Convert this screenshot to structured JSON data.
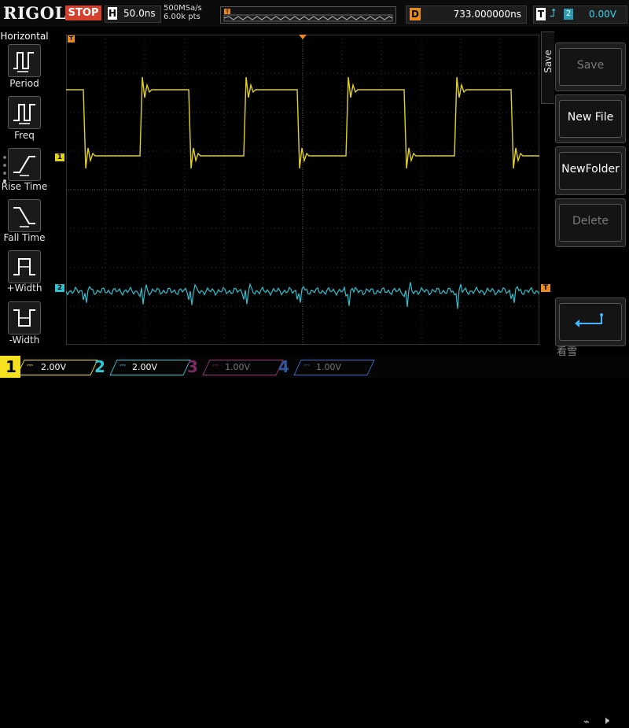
{
  "brand": "RIGOL",
  "run_state": "STOP",
  "timebase": {
    "letter": "H",
    "scale": "50.0ns"
  },
  "acquisition": {
    "sample_rate": "500MSa/s",
    "points": "6.00k pts"
  },
  "delay": {
    "letter": "D",
    "value": "733.000000ns"
  },
  "trigger": {
    "letter": "T",
    "edge_icon": "rising-edge-icon",
    "source": "2",
    "level": "0.00V"
  },
  "left_menu": {
    "title": "Horizontal",
    "items": [
      {
        "label": "Period",
        "icon": "period-icon"
      },
      {
        "label": "Freq",
        "icon": "freq-icon"
      },
      {
        "label": "Rise Time",
        "icon": "rise-time-icon"
      },
      {
        "label": "Fall Time",
        "icon": "fall-time-icon"
      },
      {
        "label": "+Width",
        "icon": "pos-width-icon"
      },
      {
        "label": "-Width",
        "icon": "neg-width-icon"
      }
    ]
  },
  "right_menu": {
    "tab": "Save",
    "items": [
      {
        "label": "Save",
        "enabled": false
      },
      {
        "label": "New File",
        "enabled": true
      },
      {
        "label": "NewFolder",
        "enabled": true
      },
      {
        "label": "Delete",
        "enabled": false
      },
      {
        "label": "",
        "icon": "enter-icon",
        "enabled": true
      }
    ]
  },
  "markers": {
    "ch1": "1",
    "ch2": "2",
    "trigger": "T"
  },
  "channels": [
    {
      "num": "1",
      "scale": "2.00V",
      "color": "#f5e11f",
      "active": true
    },
    {
      "num": "2",
      "scale": "2.00V",
      "color": "#2ec9d6",
      "active": true
    },
    {
      "num": "3",
      "scale": "1.00V",
      "color": "#a0307a",
      "active": false
    },
    {
      "num": "4",
      "scale": "1.00V",
      "color": "#3a6fc8",
      "active": false
    }
  ],
  "watermark": "看雪",
  "colors": {
    "ch1": "#e3d21a",
    "ch2": "#2fc2d0",
    "trigger": "#e88a1d",
    "stop": "#d4402b"
  }
}
